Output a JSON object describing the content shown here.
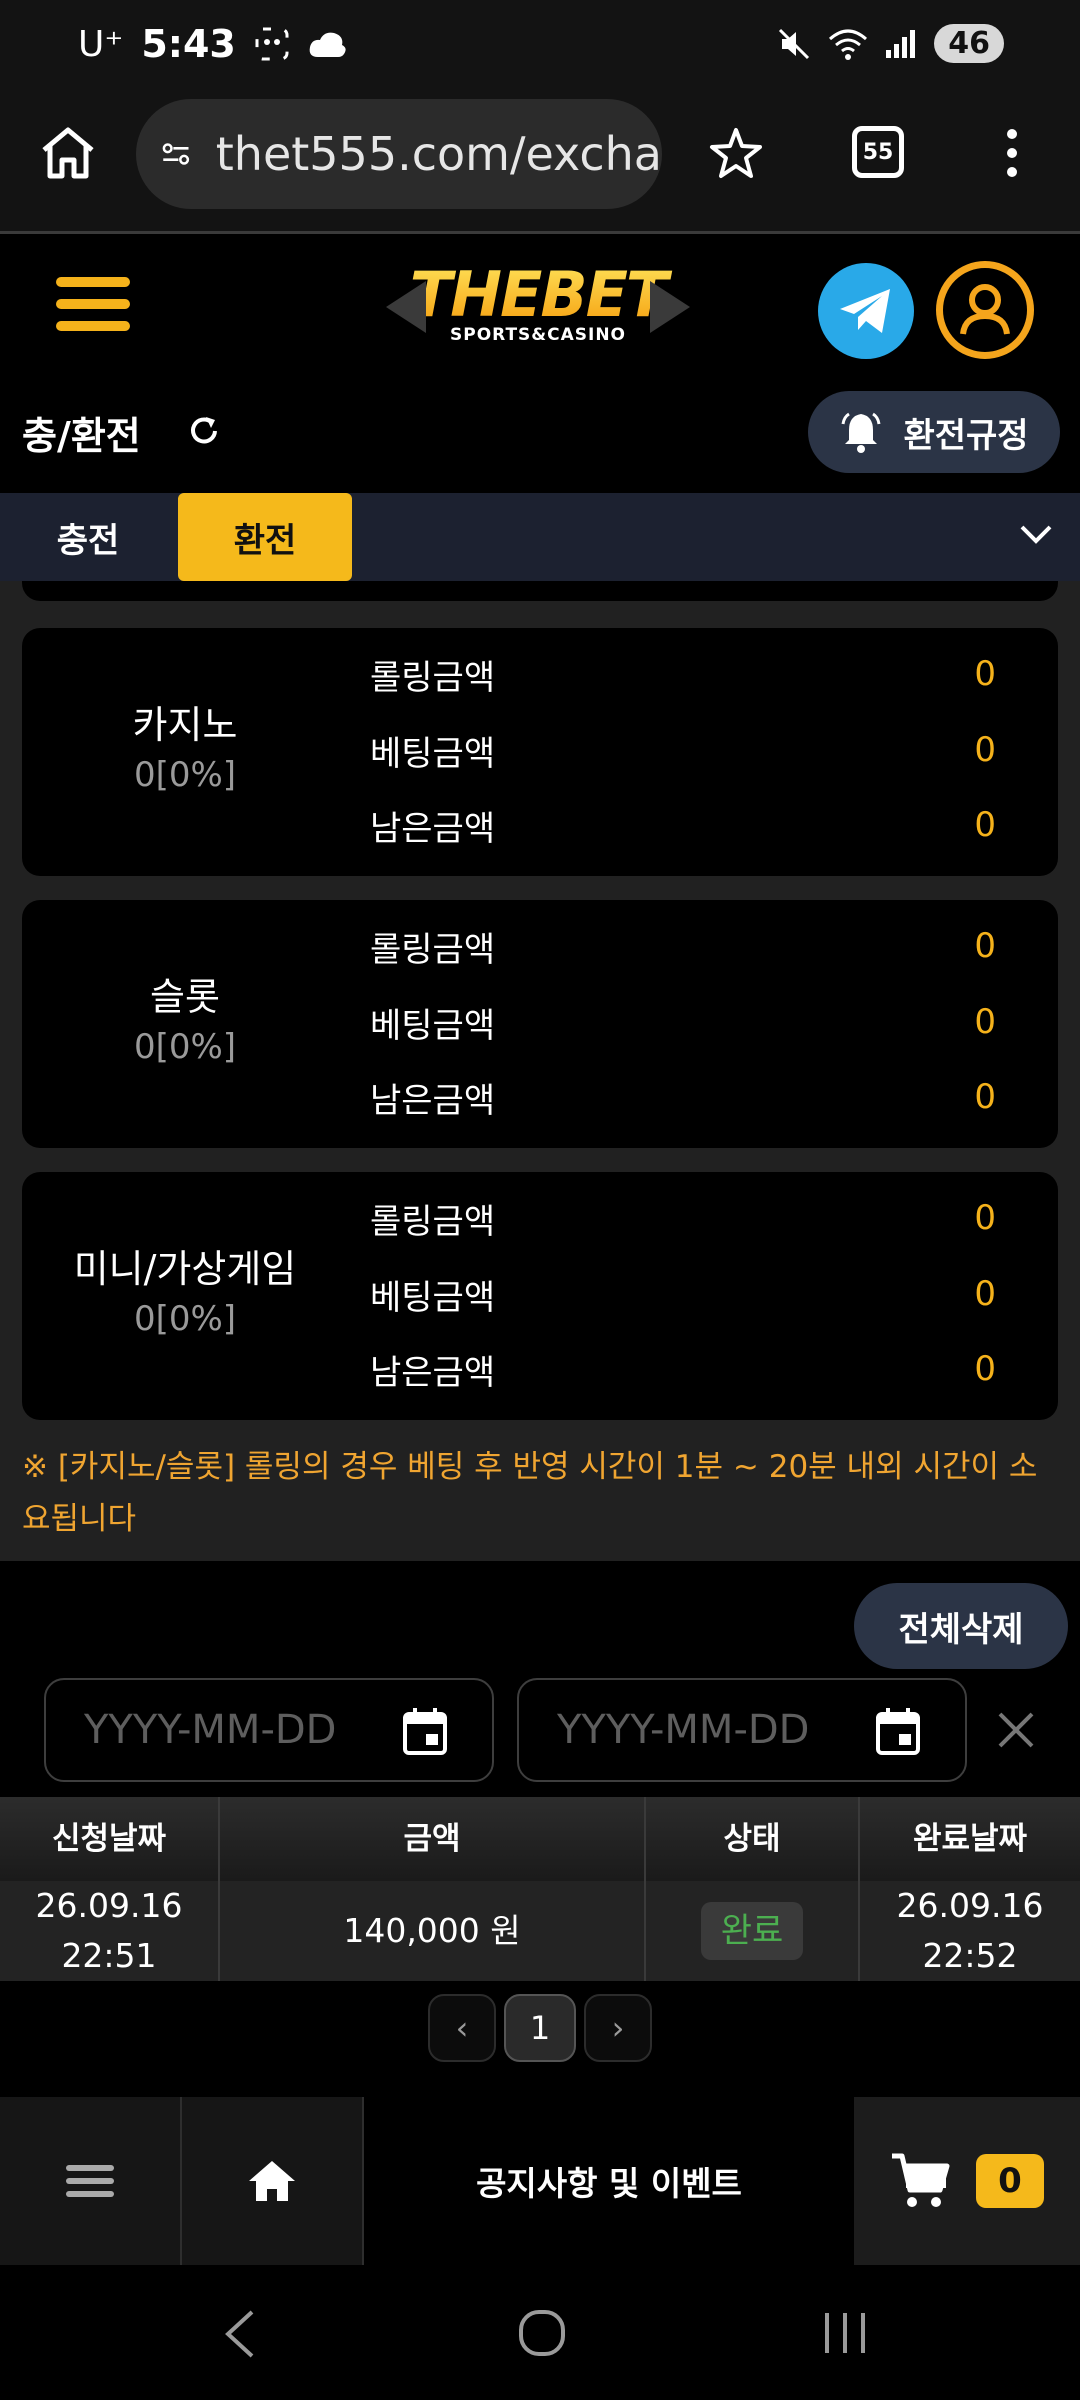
{
  "status_bar": {
    "carrier": "U⁺",
    "time": "5:43",
    "battery": "46"
  },
  "browser": {
    "url": "thet555.com/excha",
    "tab_count": "55"
  },
  "site": {
    "logo_main": "THEBET",
    "logo_sub": "SPORTS&CASINO"
  },
  "page": {
    "title": "충/환전",
    "rules_button": "환전규정"
  },
  "tabs": [
    {
      "label": "충전",
      "active": false
    },
    {
      "label": "환전",
      "active": true
    }
  ],
  "cards": [
    {
      "name": "카지노",
      "percent": "0[0%]",
      "rows": [
        {
          "label": "롤링금액",
          "value": "0"
        },
        {
          "label": "베팅금액",
          "value": "0"
        },
        {
          "label": "남은금액",
          "value": "0"
        }
      ]
    },
    {
      "name": "슬롯",
      "percent": "0[0%]",
      "rows": [
        {
          "label": "롤링금액",
          "value": "0"
        },
        {
          "label": "베팅금액",
          "value": "0"
        },
        {
          "label": "남은금액",
          "value": "0"
        }
      ]
    },
    {
      "name": "미니/가상게임",
      "percent": "0[0%]",
      "rows": [
        {
          "label": "롤링금액",
          "value": "0"
        },
        {
          "label": "베팅금액",
          "value": "0"
        },
        {
          "label": "남은금액",
          "value": "0"
        }
      ]
    }
  ],
  "notice": "※ [카지노/슬롯] 롤링의 경우 베팅 후 반영 시간이 1분 ~ 20분 내외 시간이 소요됩니다",
  "filters": {
    "delete_all": "전체삭제",
    "start_placeholder": "YYYY-MM-DD",
    "end_placeholder": "YYYY-MM-DD"
  },
  "table": {
    "headers": [
      "신청날짜",
      "금액",
      "상태",
      "완료날짜"
    ],
    "rows": [
      {
        "request_date": "26.09.16",
        "request_time": "22:51",
        "amount": "140,000 원",
        "status": "완료",
        "complete_date": "26.09.16",
        "complete_time": "22:52"
      }
    ]
  },
  "pagination": {
    "prev": "‹",
    "current": "1",
    "next": "›"
  },
  "bottom_nav": {
    "notice_label": "공지사항 및 이벤트",
    "cart_count": "0"
  },
  "colors": {
    "accent": "#f5b91b",
    "value": "#f5b21b",
    "notice": "#f0a531",
    "status_done": "#4caf50",
    "telegram": "#29a9e8"
  }
}
